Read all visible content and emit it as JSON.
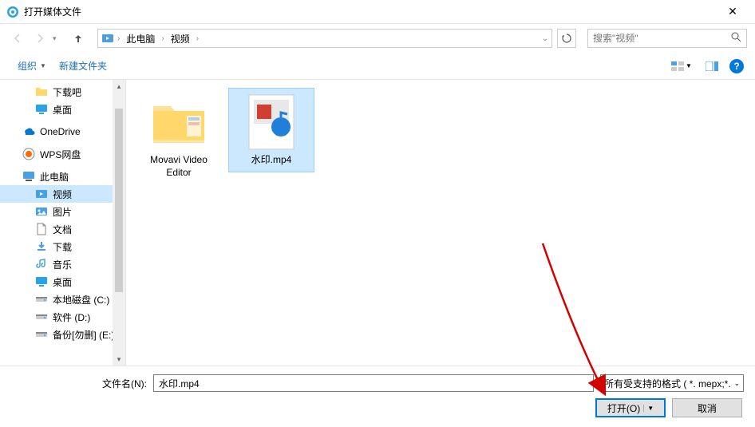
{
  "title": "打开媒体文件",
  "breadcrumb": {
    "root": "此电脑",
    "current": "视频"
  },
  "search": {
    "placeholder": "搜索\"视频\""
  },
  "toolbar": {
    "organize": "组织",
    "new_folder": "新建文件夹"
  },
  "sidebar": {
    "items": [
      {
        "label": "下载吧",
        "icon": "folder"
      },
      {
        "label": "桌面",
        "icon": "desktop-blue"
      },
      {
        "label": "OneDrive",
        "icon": "onedrive"
      },
      {
        "label": "WPS网盘",
        "icon": "wps"
      },
      {
        "label": "此电脑",
        "icon": "thispc"
      },
      {
        "label": "视频",
        "icon": "videos",
        "selected": true
      },
      {
        "label": "图片",
        "icon": "pictures"
      },
      {
        "label": "文档",
        "icon": "documents"
      },
      {
        "label": "下载",
        "icon": "downloads"
      },
      {
        "label": "音乐",
        "icon": "music"
      },
      {
        "label": "桌面",
        "icon": "desktop-blue"
      },
      {
        "label": "本地磁盘 (C:)",
        "icon": "drive"
      },
      {
        "label": "软件 (D:)",
        "icon": "drive"
      },
      {
        "label": "备份[勿删] (E:)",
        "icon": "drive"
      }
    ]
  },
  "files": [
    {
      "label": "Movavi Video Editor",
      "type": "folder"
    },
    {
      "label": "水印.mp4",
      "type": "video",
      "selected": true
    }
  ],
  "footer": {
    "filename_label": "文件名(N):",
    "filename_value": "水印.mp4",
    "filter_text": "所有受支持的格式 ( *. mepx;*.",
    "open_btn": "打开(O)",
    "cancel_btn": "取消"
  }
}
